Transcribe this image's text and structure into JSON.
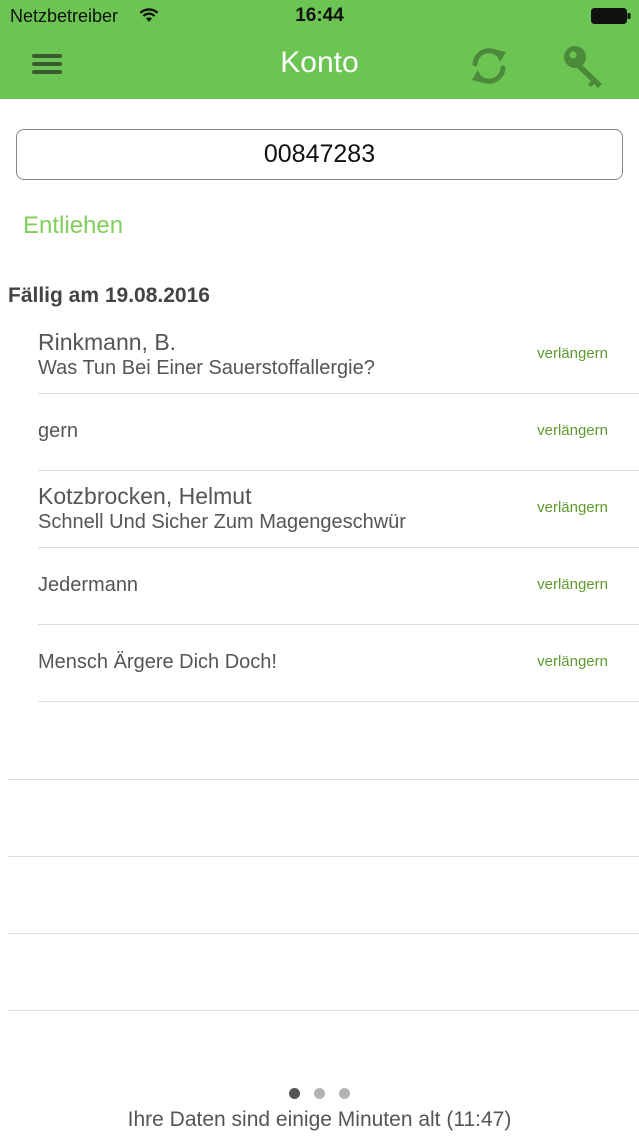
{
  "status_bar": {
    "carrier": "Netzbetreiber",
    "time": "16:44"
  },
  "nav": {
    "title": "Konto"
  },
  "account": {
    "number": "00847283"
  },
  "section": {
    "label": "Entliehen"
  },
  "due_group": {
    "heading": "Fällig am 19.08.2016"
  },
  "loans": [
    {
      "author": "Rinkmann, B.",
      "title": "Was Tun Bei Einer Sauerstoffallergie?",
      "renew_label": "verlängern"
    },
    {
      "title": "gern",
      "renew_label": "verlängern"
    },
    {
      "author": "Kotzbrocken, Helmut",
      "title": "Schnell Und Sicher Zum Magengeschwür",
      "renew_label": "verlängern"
    },
    {
      "title": "Jedermann",
      "renew_label": "verlängern"
    },
    {
      "title": "Mensch Ärgere Dich Doch!",
      "renew_label": "verlängern"
    }
  ],
  "pager": {
    "count": 3,
    "active": 0
  },
  "footer": {
    "note": "Ihre Daten sind einige Minuten alt (11:47)"
  },
  "colors": {
    "accent": "#6cc552",
    "section_label": "#7fcf5a",
    "renew_link": "#5e9a2e"
  },
  "icons": {
    "menu": "hamburger-icon",
    "refresh": "refresh-icon",
    "key": "key-icon",
    "wifi": "wifi-icon",
    "battery": "battery-icon"
  }
}
